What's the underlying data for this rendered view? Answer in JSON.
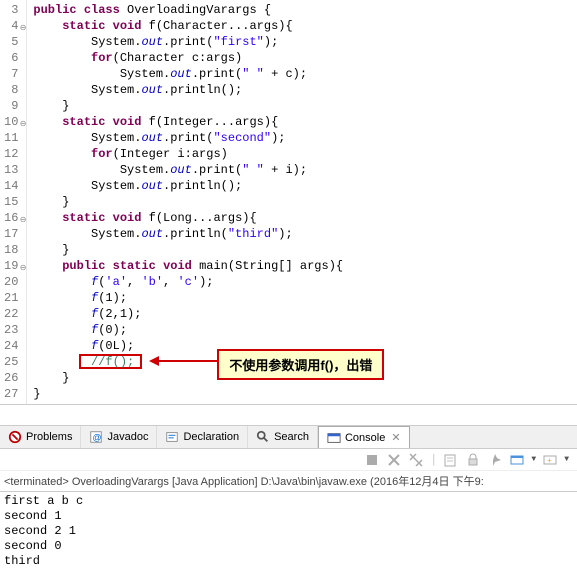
{
  "editor": {
    "lines": [
      {
        "num": "3",
        "fold": false,
        "html": "<span class='kw'>public</span> <span class='kw'>class</span> OverloadingVarargs {"
      },
      {
        "num": "4",
        "fold": true,
        "html": "    <span class='kw'>static</span> <span class='kw'>void</span> f(Character...args){"
      },
      {
        "num": "5",
        "fold": false,
        "html": "        System.<span class='field'>out</span>.print(<span class='str'>\"first\"</span>);"
      },
      {
        "num": "6",
        "fold": false,
        "html": "        <span class='kw'>for</span>(Character c:args)"
      },
      {
        "num": "7",
        "fold": false,
        "html": "            System.<span class='field'>out</span>.print(<span class='str'>\" \"</span> + c);"
      },
      {
        "num": "8",
        "fold": false,
        "html": "        System.<span class='field'>out</span>.println();"
      },
      {
        "num": "9",
        "fold": false,
        "html": "    }"
      },
      {
        "num": "10",
        "fold": true,
        "html": "    <span class='kw'>static</span> <span class='kw'>void</span> f(Integer...args){"
      },
      {
        "num": "11",
        "fold": false,
        "html": "        System.<span class='field'>out</span>.print(<span class='str'>\"second\"</span>);"
      },
      {
        "num": "12",
        "fold": false,
        "html": "        <span class='kw'>for</span>(Integer i:args)"
      },
      {
        "num": "13",
        "fold": false,
        "html": "            System.<span class='field'>out</span>.print(<span class='str'>\" \"</span> + i);"
      },
      {
        "num": "14",
        "fold": false,
        "html": "        System.<span class='field'>out</span>.println();"
      },
      {
        "num": "15",
        "fold": false,
        "html": "    }"
      },
      {
        "num": "16",
        "fold": true,
        "html": "    <span class='kw'>static</span> <span class='kw'>void</span> f(Long...args){"
      },
      {
        "num": "17",
        "fold": false,
        "html": "        System.<span class='field'>out</span>.println(<span class='str'>\"third\"</span>);"
      },
      {
        "num": "18",
        "fold": false,
        "html": "    }"
      },
      {
        "num": "19",
        "fold": true,
        "html": "    <span class='kw'>public</span> <span class='kw'>static</span> <span class='kw'>void</span> main(String[] args){"
      },
      {
        "num": "20",
        "fold": false,
        "html": "        <span class='field'>f</span>(<span class='str'>'a'</span>, <span class='str'>'b'</span>, <span class='str'>'c'</span>);"
      },
      {
        "num": "21",
        "fold": false,
        "html": "        <span class='field'>f</span>(1);"
      },
      {
        "num": "22",
        "fold": false,
        "html": "        <span class='field'>f</span>(2,1);"
      },
      {
        "num": "23",
        "fold": false,
        "html": "        <span class='field'>f</span>(0);"
      },
      {
        "num": "24",
        "fold": false,
        "html": "        <span class='field'>f</span>(0L);"
      },
      {
        "num": "25",
        "fold": false,
        "html": "        <span class='com'>//f();</span>"
      },
      {
        "num": "26",
        "fold": false,
        "html": "    }"
      },
      {
        "num": "27",
        "fold": false,
        "html": "}"
      }
    ]
  },
  "annotation": {
    "callout_text": "不使用参数调用f()，出错"
  },
  "tabs": {
    "problems": "Problems",
    "javadoc": "Javadoc",
    "declaration": "Declaration",
    "search": "Search",
    "console": "Console"
  },
  "console": {
    "terminated": "<terminated> OverloadingVarargs [Java Application] D:\\Java\\bin\\javaw.exe (2016年12月4日 下午9:",
    "output": [
      "first a b c",
      "second 1",
      "second 2 1",
      "second 0",
      "third"
    ]
  }
}
